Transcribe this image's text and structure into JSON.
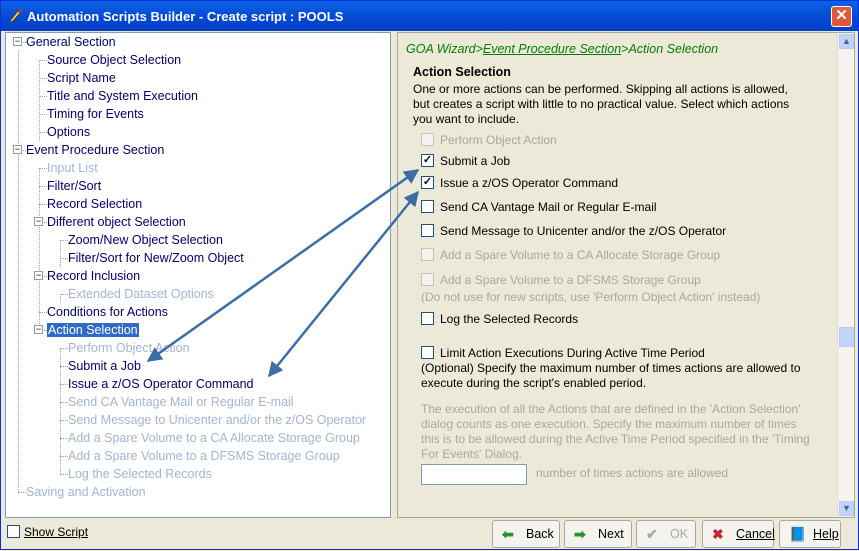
{
  "window": {
    "title": "Automation Scripts Builder - Create script : POOLS"
  },
  "tree": {
    "items": [
      {
        "label": "General Section",
        "state": "normal",
        "toggle": "-"
      },
      {
        "label": "Source Object Selection",
        "state": "normal"
      },
      {
        "label": "Script Name",
        "state": "normal"
      },
      {
        "label": "Title and System Execution",
        "state": "normal"
      },
      {
        "label": "Timing for Events",
        "state": "normal"
      },
      {
        "label": "Options",
        "state": "normal"
      },
      {
        "label": "Event Procedure Section",
        "state": "normal",
        "toggle": "-"
      },
      {
        "label": "Input List",
        "state": "disabled"
      },
      {
        "label": "Filter/Sort",
        "state": "normal"
      },
      {
        "label": "Record Selection",
        "state": "normal"
      },
      {
        "label": "Different object Selection",
        "state": "normal",
        "toggle": "-"
      },
      {
        "label": "Zoom/New Object Selection",
        "state": "normal"
      },
      {
        "label": "Filter/Sort for New/Zoom Object",
        "state": "normal"
      },
      {
        "label": "Record Inclusion",
        "state": "normal",
        "toggle": "-"
      },
      {
        "label": "Extended Dataset Options",
        "state": "disabled"
      },
      {
        "label": "Conditions for Actions",
        "state": "normal"
      },
      {
        "label": "Action Selection",
        "state": "selected",
        "toggle": "-"
      },
      {
        "label": "Perform Object Action",
        "state": "disabled"
      },
      {
        "label": "Submit a Job",
        "state": "normal"
      },
      {
        "label": "Issue a z/OS Operator Command",
        "state": "normal"
      },
      {
        "label": "Send CA Vantage Mail or Regular E-mail",
        "state": "disabled"
      },
      {
        "label": "Send Message to Unicenter and/or the z/OS Operator",
        "state": "disabled"
      },
      {
        "label": "Add a Spare Volume to a CA Allocate Storage Group",
        "state": "disabled"
      },
      {
        "label": "Add a Spare Volume to a DFSMS Storage Group",
        "state": "disabled"
      },
      {
        "label": "Log the Selected Records",
        "state": "disabled"
      },
      {
        "label": "Saving and Activation",
        "state": "disabled"
      }
    ]
  },
  "breadcrumb": {
    "prefix": "GOA Wizard>",
    "link": "Event Procedure Section",
    "suffix": ">Action Selection"
  },
  "section": {
    "title": "Action Selection",
    "description": "One or more actions can be performed. Skipping all actions is allowed, but creates a script with little to no practical value. Select which actions you want to include."
  },
  "actions": [
    {
      "label": "Perform Object Action",
      "checked": false,
      "disabled": true
    },
    {
      "label": "Submit a Job",
      "checked": true,
      "disabled": false
    },
    {
      "label": "Issue a z/OS Operator Command",
      "checked": true,
      "disabled": false
    },
    {
      "label": "Send CA Vantage Mail or Regular E-mail",
      "checked": false,
      "disabled": false
    },
    {
      "label": "Send Message to Unicenter and/or the z/OS Operator",
      "checked": false,
      "disabled": false
    },
    {
      "label": "Add a Spare Volume to a CA Allocate Storage Group",
      "checked": false,
      "disabled": true
    },
    {
      "label": "Add a Spare Volume to a DFSMS Storage Group",
      "checked": false,
      "disabled": true
    },
    {
      "label": "Log the Selected Records",
      "checked": false,
      "disabled": false
    },
    {
      "label": "Limit Action Executions During Active Time Period",
      "checked": false,
      "disabled": false
    }
  ],
  "dfsms_note": "(Do not use for new scripts, use 'Perform Object Action' instead)",
  "limit_note": "(Optional) Specify the maximum number of times actions are allowed to execute during the script's enabled period.",
  "execution_note": "The execution of all the Actions that are defined in the 'Action Selection' dialog counts as one execution. Specify the maximum number of times this is to be allowed during the Active Time Period specified in the 'Timing For Events' Dialog.",
  "count_field": {
    "value": "",
    "label": "number of times actions are allowed"
  },
  "bottom": {
    "show_script": "Show Script",
    "back": "Back",
    "next": "Next",
    "ok": "OK",
    "cancel": "Cancel",
    "help": "Help"
  },
  "colors": {
    "titlebar": "#0347d3",
    "selection": "#316ac5",
    "breadcrumb": "#008000",
    "tree_text": "#00006b",
    "arrow": "#3a6ea5"
  }
}
